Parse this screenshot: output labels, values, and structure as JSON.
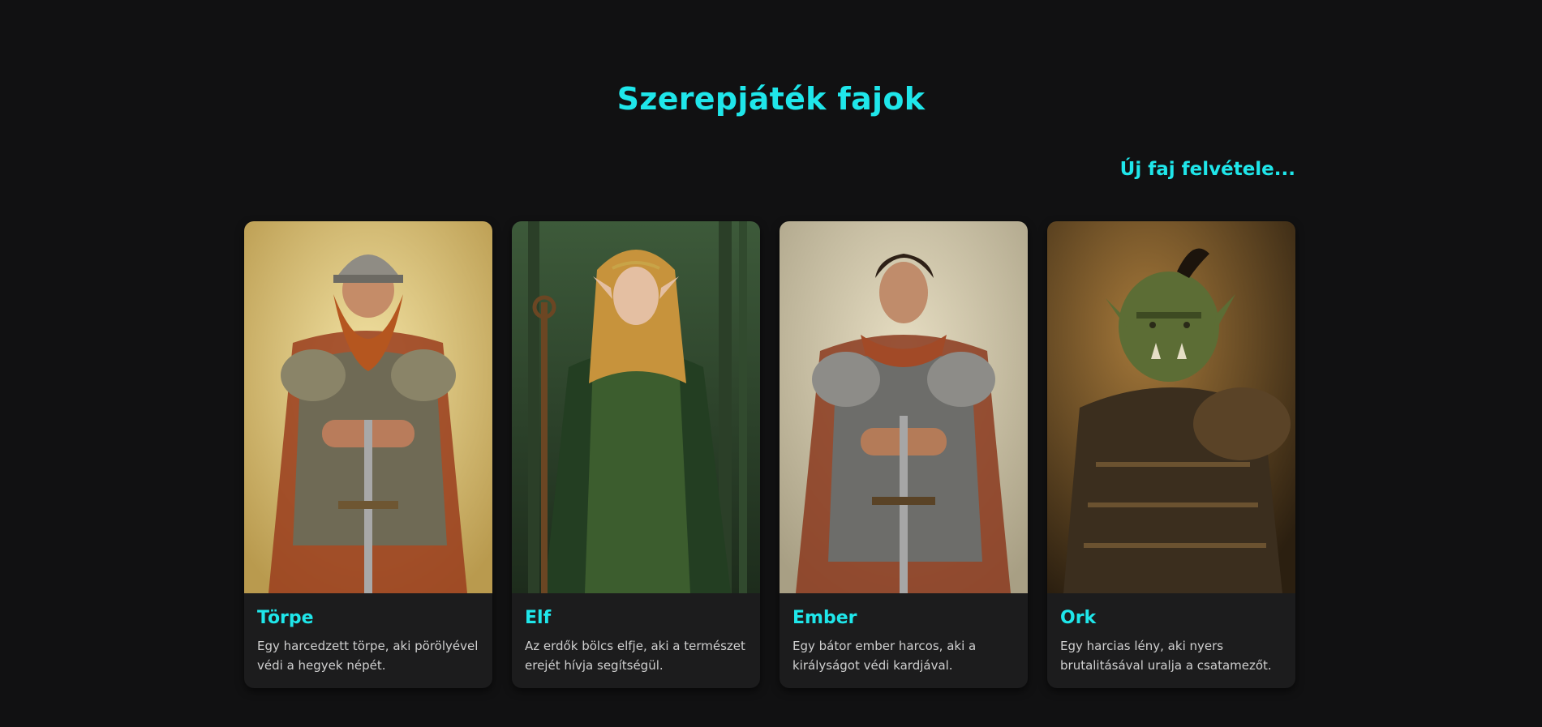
{
  "page": {
    "title": "Szerepjáték fajok",
    "add_link": "Új faj felvétele..."
  },
  "races": [
    {
      "name": "Törpe",
      "description": "Egy harcedzett törpe, aki pörölyével védi a hegyek népét.",
      "portrait_icon": "dwarf-portrait"
    },
    {
      "name": "Elf",
      "description": "Az erdők bölcs elfje, aki a természet erejét hívja segítségül.",
      "portrait_icon": "elf-portrait"
    },
    {
      "name": "Ember",
      "description": "Egy bátor ember harcos, aki a királyságot védi kardjával.",
      "portrait_icon": "human-portrait"
    },
    {
      "name": "Ork",
      "description": "Egy harcias lény, aki nyers brutalitásával uralja a csatamezőt.",
      "portrait_icon": "orc-portrait"
    }
  ],
  "colors": {
    "accent": "#1fe6ea",
    "background": "#111112",
    "card": "#1c1c1d"
  }
}
